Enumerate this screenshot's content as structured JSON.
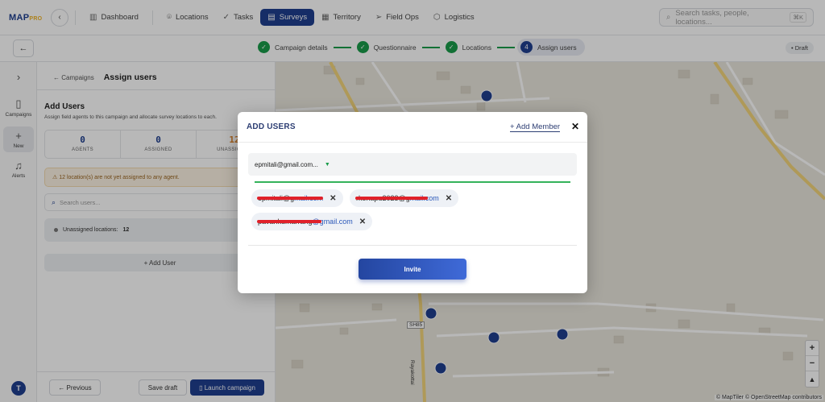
{
  "app": {
    "logo_main": "MAP",
    "logo_accent": "PRO"
  },
  "nav": {
    "back_icon": "chevron-left-icon",
    "items": [
      {
        "label": "Dashboard",
        "icon": "bar-chart-icon"
      },
      {
        "label": "Locations",
        "icon": "pin-icon"
      },
      {
        "label": "Tasks",
        "icon": "check-icon"
      },
      {
        "label": "Surveys",
        "icon": "clipboard-icon",
        "active": true
      },
      {
        "label": "Territory",
        "icon": "map-icon"
      },
      {
        "label": "Field Ops",
        "icon": "send-icon"
      },
      {
        "label": "Logistics",
        "icon": "box-icon"
      }
    ],
    "search_placeholder": "Search tasks, people, locations...",
    "search_shortcut": "⌘K"
  },
  "stepper": {
    "steps": [
      {
        "label": "Campaign details",
        "mark": "✓"
      },
      {
        "label": "Questionnaire",
        "mark": "✓"
      },
      {
        "label": "Locations",
        "mark": "✓"
      },
      {
        "label": "Assign users",
        "mark": "4",
        "current": true
      }
    ],
    "status": "• Draft"
  },
  "rail": {
    "campaigns": "Campaigns",
    "new": "New",
    "alerts": "Alerts",
    "avatar": "T"
  },
  "panel": {
    "breadcrumb": "← Campaigns",
    "title": "Assign users",
    "section_title": "Add Users",
    "section_sub": "Assign field agents to this campaign and allocate survey locations to each.",
    "stats": [
      {
        "value": "0",
        "label": "AGENTS"
      },
      {
        "value": "0",
        "label": "ASSIGNED"
      },
      {
        "value": "12",
        "label": "UNASSIGNED"
      }
    ],
    "warning": "⚠ 12 location(s) are not yet assigned to any agent.",
    "search_placeholder": "Search users...",
    "unassigned_label": "Unassigned locations:",
    "unassigned_count": "12",
    "add_user": "+ Add User",
    "btn_previous": "← Previous",
    "btn_save_draft": "Save draft",
    "btn_launch": "▯ Launch campaign"
  },
  "map": {
    "road_label_1": "SH85",
    "road_label_2": "Rayakottai",
    "attribution": "© MapTiler © OpenStreetMap contributors",
    "zoom_in": "+",
    "zoom_out": "−",
    "compass": "▲"
  },
  "modal": {
    "title": "ADD USERS",
    "add_member": "+ Add Member",
    "close": "✕",
    "selected_value": "epmitali@gmail.com...",
    "chips": [
      {
        "local": "epmitali@g",
        "domain": "mail.com"
      },
      {
        "local": "rkonapu2023@g",
        "domain": "mail.com"
      },
      {
        "local": "pavankumarrang",
        "domain": "@gmail.com"
      }
    ],
    "invite": "Invite"
  }
}
